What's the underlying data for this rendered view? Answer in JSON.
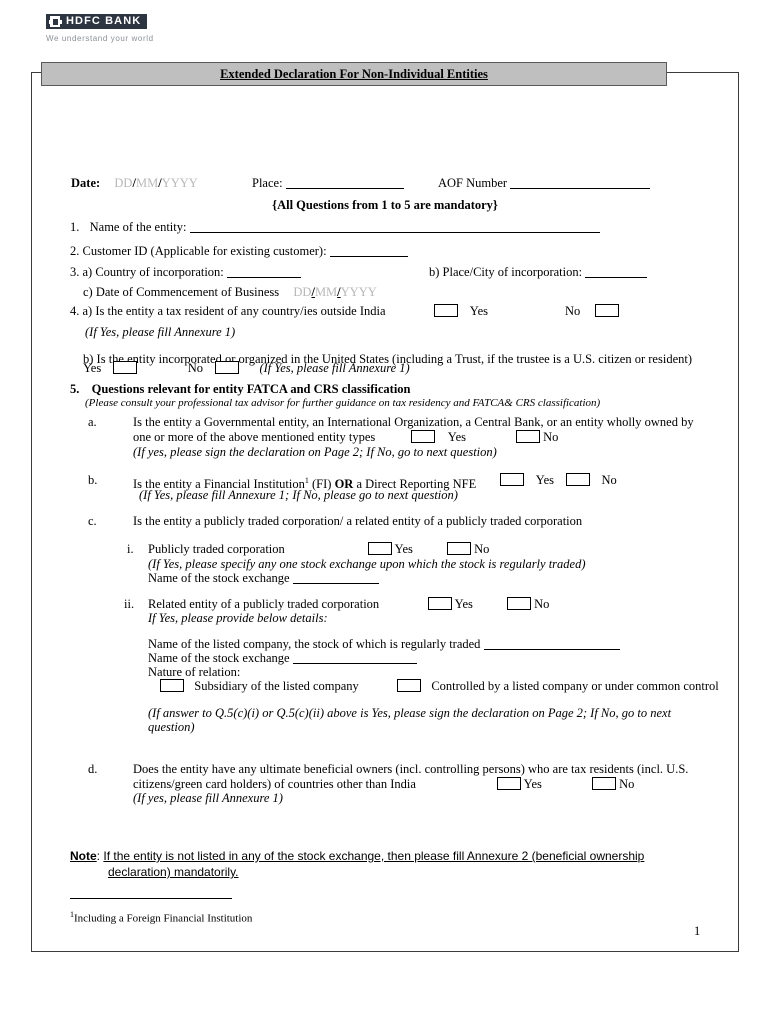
{
  "document": {
    "brand": {
      "name": "HDFC BANK",
      "tagline": "We understand your world",
      "logo_icon": "hdfc-square-mark",
      "bar_color": "#2d3540"
    },
    "title": "Extended Declaration For Non-Individual Entities",
    "title_bar_color": "#bfbfbf",
    "page_number": "1"
  },
  "meta_row": {
    "date_label": "Date:",
    "date_dd": "DD",
    "date_mm": "MM",
    "date_yyyy": "YYYY",
    "slash": "/",
    "place_label": "Place:",
    "aof_label": "AOF Number"
  },
  "mandatory_note": "{All Questions from 1 to 5 are mandatory}",
  "questions": {
    "q1": {
      "number": "1.",
      "text": "Name of the entity:"
    },
    "q2": {
      "number": "2.",
      "text": "Customer ID (Applicable for existing customer):"
    },
    "q3": {
      "number": "3.",
      "a_label": "a) Country of incorporation:",
      "b_label": "b) Place/City of incorporation:",
      "c_label": "c) Date of Commencement of Business",
      "c_dd": "DD",
      "c_mm": "MM",
      "c_yyyy": "YYYY"
    },
    "q4": {
      "number": "4.",
      "a_text": "a) Is the entity a tax resident of any country/ies outside India",
      "a_yes": "Yes",
      "a_no": "No",
      "a_hint": "(If Yes, please fill Annexure 1)",
      "b_text": "b) Is the entity incorporated or organized in the United States (including a Trust, if the trustee is a U.S. citizen or resident)",
      "b_yes": "Yes",
      "b_no": "No",
      "b_hint": "(If Yes, please fill Annexure 1)"
    },
    "q5": {
      "number": "5.",
      "heading": "Questions relevant for entity FATCA and CRS classification",
      "subheading": "(Please consult your professional tax advisor for further guidance on tax residency and FATCA& CRS classification)",
      "a": {
        "marker": "a.",
        "line1": "Is the entity a Governmental entity, an International Organization, a Central Bank, or an entity wholly owned by",
        "line2": "one or more of the above mentioned entity types",
        "yes": "Yes",
        "no": "No",
        "hint": "(If yes, please sign the declaration on Page 2; If No, go to next question)"
      },
      "b": {
        "marker": "b.",
        "text_pre": "Is the entity a Financial Institution",
        "footnote_ref": "1",
        "text_mid": " (FI) ",
        "text_or": "OR",
        "text_post": " a Direct Reporting NFE",
        "yes": "Yes",
        "no": "No",
        "hint": "(If Yes, please fill Annexure 1; If No, please go to next question)"
      },
      "c": {
        "marker": "c.",
        "text": "Is the entity a publicly traded corporation/ a related entity of a publicly traded corporation",
        "i": {
          "marker": "i.",
          "text": "Publicly traded corporation",
          "yes": "Yes",
          "no": "No",
          "hint": "(If Yes, please specify any one stock exchange upon which the stock is regularly traded)",
          "exchange_label": "Name of the stock exchange"
        },
        "ii": {
          "marker": "ii.",
          "text": "Related entity of a publicly traded corporation",
          "yes": "Yes",
          "no": "No",
          "hint": "If Yes, please provide below details:",
          "listed_company_label": "Name of the listed company, the stock of which is regularly traded",
          "exchange_label": "Name of the stock exchange",
          "nature_label": "Nature of relation:",
          "option_subsidiary": "Subsidiary of the listed company",
          "option_controlled": "Controlled by a listed company or under common control"
        },
        "hint_line1": "(If answer to Q.5(c)(i) or Q.5(c)(ii) above is Yes, please sign the declaration on Page 2; If No, go to next",
        "hint_line2": "question)"
      },
      "d": {
        "marker": "d.",
        "line1": "Does the entity have any ultimate beneficial owners (incl. controlling persons) who are tax residents (incl. U.S.",
        "line2": "citizens/green card holders) of countries other than India",
        "yes": "Yes",
        "no": "No",
        "hint": "(If yes, please fill Annexure 1)"
      }
    }
  },
  "note": {
    "label": "Note",
    "colon": ":",
    "line1": "If the entity is not listed in any of the stock exchange,  then please fill Annexure 2 (beneficial ownership",
    "line2": "declaration) mandatorily."
  },
  "footnote": {
    "ref": "1",
    "text": "Including a Foreign Financial Institution"
  }
}
